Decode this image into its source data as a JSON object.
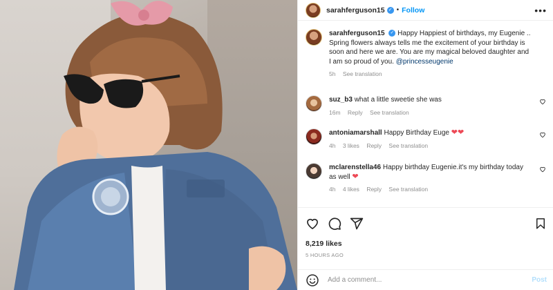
{
  "post": {
    "username": "sarahferguson15",
    "follow_label": "Follow",
    "dot": "•",
    "more": "•••",
    "caption": {
      "username": "sarahferguson15",
      "text": "Happy Happiest of birthdays, my Eugenie .. Spring flowers always tells me the excitement of your birthday is soon and here we are. You are my magical beloved daughter and I am so proud of you.",
      "mention": "@princesseugenie",
      "time": "5h",
      "see_translation": "See translation"
    },
    "comments": [
      {
        "username": "suz_b3",
        "text": "what a little sweetie she was",
        "time": "16m",
        "likes": "",
        "reply": "Reply",
        "see_translation": "See translation",
        "hearts": ""
      },
      {
        "username": "antoniamarshall",
        "text": "Happy Birthday Euge",
        "time": "4h",
        "likes": "3 likes",
        "reply": "Reply",
        "see_translation": "See translation",
        "hearts": "❤❤"
      },
      {
        "username": "mclarenstella46",
        "text": "Happy birthday Eugenie.it's my birthday today as well",
        "time": "4h",
        "likes": "4 likes",
        "reply": "Reply",
        "see_translation": "See translation",
        "hearts": "❤"
      }
    ],
    "likes": "8,219 likes",
    "posted_ago": "5 HOURS AGO",
    "add_comment_placeholder": "Add a comment...",
    "post_label": "Post",
    "colors": {
      "link": "#0095f6",
      "verified": "#3897f0",
      "heart": "#ed4956",
      "muted": "#8e8e8e"
    },
    "icons": [
      "verified-badge-icon",
      "heart-icon",
      "comment-icon",
      "share-icon",
      "bookmark-icon",
      "emoji-icon"
    ]
  }
}
